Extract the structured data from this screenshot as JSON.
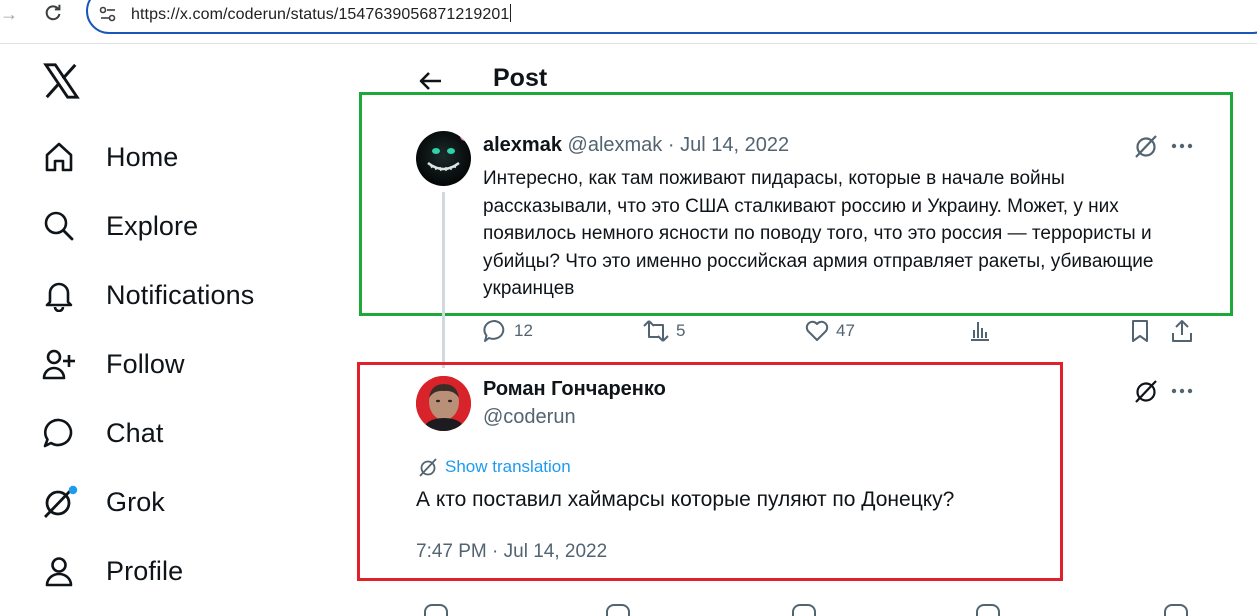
{
  "browser": {
    "url": "https://x.com/coderun/status/1547639056871219201"
  },
  "sidebar": {
    "items": [
      {
        "label": "Home",
        "icon": "home-icon"
      },
      {
        "label": "Explore",
        "icon": "search-icon"
      },
      {
        "label": "Notifications",
        "icon": "bell-icon"
      },
      {
        "label": "Follow",
        "icon": "follow-icon"
      },
      {
        "label": "Chat",
        "icon": "chat-icon"
      },
      {
        "label": "Grok",
        "icon": "grok-icon"
      },
      {
        "label": "Profile",
        "icon": "profile-icon"
      }
    ]
  },
  "header": {
    "title": "Post"
  },
  "tweet1": {
    "name": "alexmak",
    "handle": "@alexmak",
    "separator": " · ",
    "date": "Jul 14, 2022",
    "text": "Интересно, как там поживают пидарасы, которые в начале войны рассказывали, что это США сталкивают россию и Украину. Может, у них появилось немного ясности по поводу того, что это россия — террористы и убийцы? Что это именно российская армия отправляет ракеты, убивающие украинцев",
    "replies": "12",
    "reposts": "5",
    "likes": "47"
  },
  "tweet2": {
    "name": "Роман Гончаренко",
    "handle": "@coderun",
    "show_translation": "Show translation",
    "text": "А кто поставил хаймарсы которые пуляют по Донецку?",
    "timestamp": "7:47 PM · Jul 14, 2022"
  },
  "colors": {
    "accent": "#1d9bf0",
    "highlight_green": "#1fa83a",
    "highlight_red": "#e0202a",
    "muted": "#536471"
  }
}
